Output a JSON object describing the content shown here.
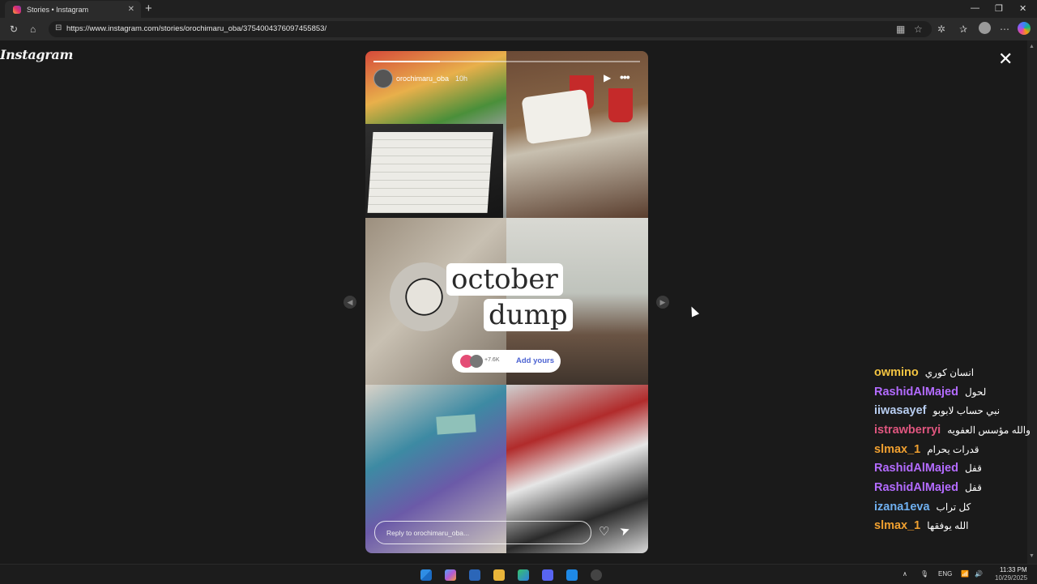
{
  "browser": {
    "tab_title": "Stories • Instagram",
    "url": "https://www.instagram.com/stories/orochimaru_oba/3754004376097455853/"
  },
  "page": {
    "logo": "Instagram",
    "close_label": "✕"
  },
  "story": {
    "username": "orochimaru_oba",
    "time": "10h",
    "sticker_line1": "october",
    "sticker_line2": "dump",
    "add_yours_count": "+7.6K",
    "add_yours_label": "Add yours",
    "reply_placeholder": "Reply to orochimaru_oba...",
    "progress_segments": 2,
    "progress_current_fraction": 0.5
  },
  "chat": [
    {
      "user": "owmino",
      "message": "انسان كوري",
      "color": "#f4c542"
    },
    {
      "user": "RashidAlMajed",
      "message": "لحول",
      "color": "#b36bff"
    },
    {
      "user": "iiwasayef",
      "message": "نبي حساب لابوبو",
      "color": "#b7cdf0"
    },
    {
      "user": "istrawberryi",
      "message": "والله مؤسس العفويه",
      "color": "#e0567f"
    },
    {
      "user": "slmax_1",
      "message": "قدرات يحرام",
      "color": "#f0a030"
    },
    {
      "user": "RashidAlMajed",
      "message": "قفل",
      "color": "#b36bff"
    },
    {
      "user": "RashidAlMajed",
      "message": "قفل",
      "color": "#b36bff"
    },
    {
      "user": "izana1eva",
      "message": "كل تراب",
      "color": "#6fb0f0"
    },
    {
      "user": "slmax_1",
      "message": "الله يوفقها",
      "color": "#f0a030"
    }
  ],
  "taskbar": {
    "lang": "ENG",
    "time": "11:33 PM",
    "date": "10/29/2025"
  }
}
